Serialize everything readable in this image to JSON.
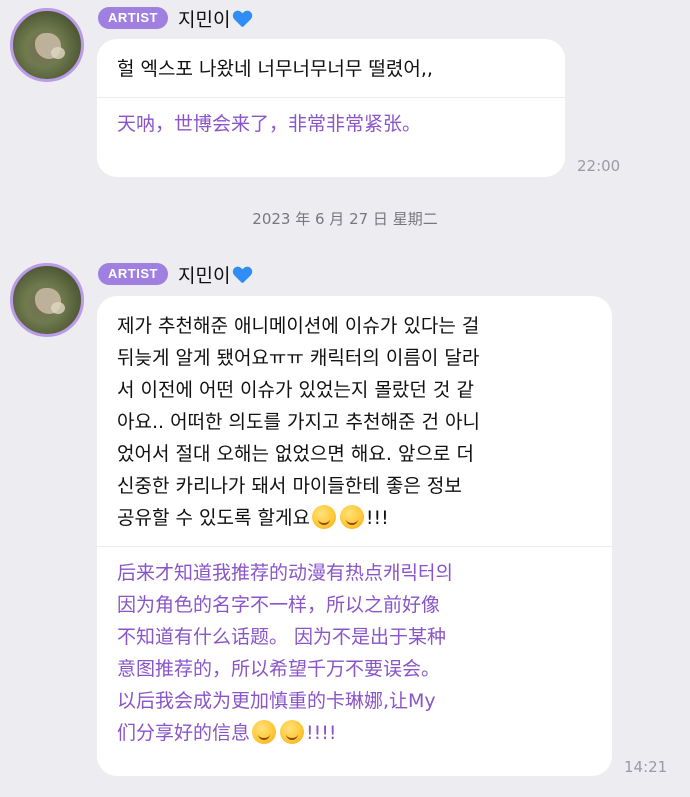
{
  "messages": [
    {
      "badge": "ARTIST",
      "name": "지민이",
      "ko": "헐 엑스포 나왔네 너무너무너무 떨렸어,,",
      "zh": "天呐，世博会来了，非常非常紧张。",
      "time": "22:00"
    },
    {
      "badge": "ARTIST",
      "name": "지민이",
      "ko": "제가 추천해준 애니메이션에 이슈가 있다는 걸\n뒤늦게 알게 됐어요ㅠㅠ 캐릭터의 이름이 달라\n서 이전에 어떤 이슈가 있었는지 몰랐던 것 같\n아요.. 어떠한 의도를 가지고 추천해준 건 아니\n었어서 절대 오해는 없었으면 해요. 앞으로 더\n신중한 카리나가 돼서 마이들한테 좋은 정보\n공유할 수 있도록 할게요",
      "ko_suffix": "!!!",
      "zh": "后来才知道我推荐的动漫有热点캐릭터의\n因为角色的名字不一样，所以之前好像\n不知道有什么话题。 因为不是出于某种\n意图推荐的，所以希望千万不要误会。\n以后我会成为更加慎重的卡琳娜,让My\n们分享好的信息",
      "zh_suffix": "!!!!",
      "time": "14:21"
    }
  ],
  "date_divider": "2023 年 6 月 27 日  星期二",
  "icons": {
    "heart": "blue-heart-icon",
    "emoji": "hugging-face-emoji"
  },
  "colors": {
    "background": "#ededf1",
    "badge": "#9f7fe0",
    "translation_text": "#8a55c9",
    "avatar_ring": "#b99be8",
    "heart": "#2f8df5"
  }
}
